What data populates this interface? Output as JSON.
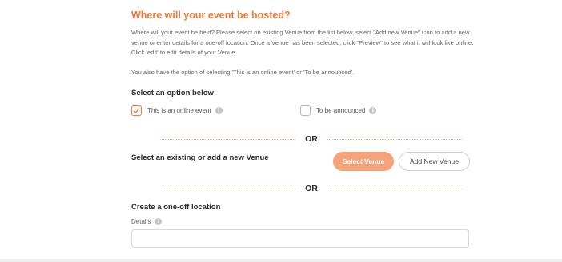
{
  "header": {
    "title": "Where will your event be hosted?"
  },
  "description": {
    "paragraph1": "Where will your event be held? Please select on existing Venue from the list below, select \"Add new Venue\" icon to add a new venue or enter details for a one-off location. Once a Venue has been selected, click \"Preview\" to see what it will look like online. Click 'edit' to edit details of your Venue.",
    "paragraph2": "You also have the option of selecting 'This is an online event' or 'To be announced'."
  },
  "options": {
    "heading": "Select an option below",
    "online_event": {
      "label": "This is an online event",
      "checked": true
    },
    "to_be_announced": {
      "label": "To be announced",
      "checked": false
    },
    "info_icon_glyph": "i"
  },
  "dividers": {
    "or_label_1": "OR",
    "or_label_2": "OR"
  },
  "venue": {
    "heading": "Select an existing or add a new Venue",
    "select_button": "Select Venue",
    "add_button": "Add New Venue"
  },
  "one_off": {
    "heading": "Create a one-off location",
    "details_label": "Details",
    "details_value": ""
  },
  "colors": {
    "accent": "#f07a3a",
    "primary_button": "#f5a37a"
  }
}
